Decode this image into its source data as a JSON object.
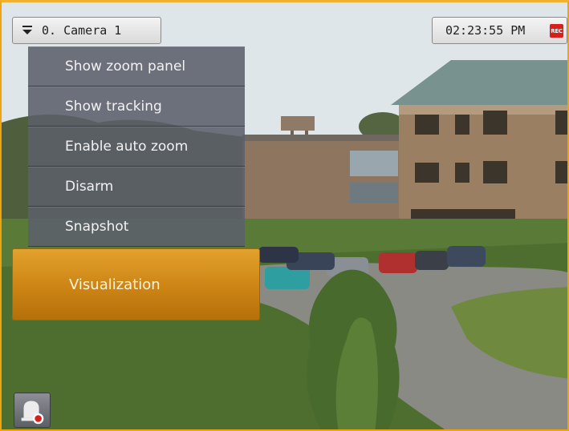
{
  "camera_selector": {
    "label": "0. Camera 1",
    "icon": "chevron-down-icon"
  },
  "clock": {
    "time": "02:23:55 PM",
    "rec_label": "REC",
    "rec_color": "#d8201a"
  },
  "context_menu": {
    "items": [
      {
        "label": "Show zoom panel"
      },
      {
        "label": "Show tracking"
      },
      {
        "label": "Enable auto zoom"
      },
      {
        "label": "Disarm"
      },
      {
        "label": "Snapshot"
      }
    ],
    "highlighted_item": {
      "label": "Visualization"
    }
  },
  "accent_color": "#f0a30a",
  "corner_button": {
    "icon": "alarm-bell-icon"
  }
}
